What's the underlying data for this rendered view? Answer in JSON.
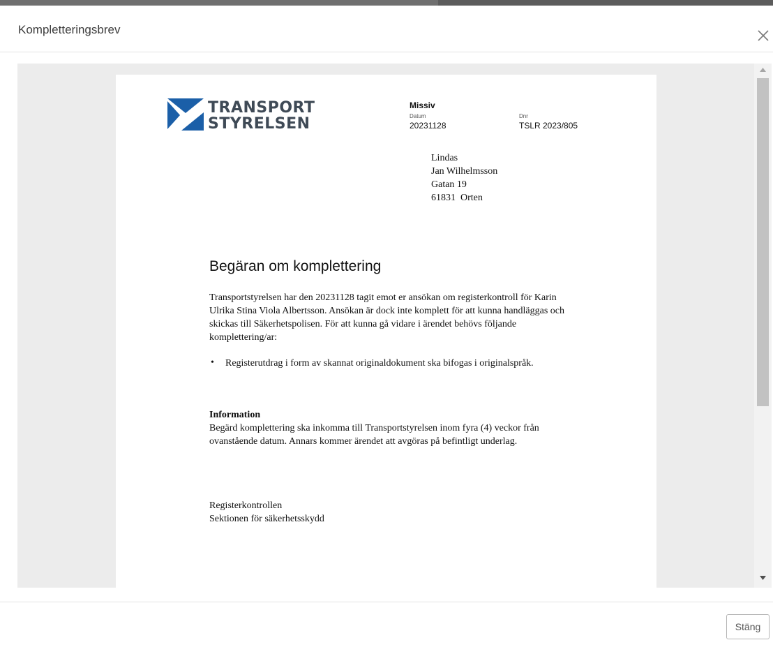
{
  "dialog": {
    "title": "Kompletteringsbrev",
    "close_button": "Stäng"
  },
  "letter": {
    "logo": {
      "line1": "TRANSPORT",
      "line2": "STYRELSEN"
    },
    "missiv_label": "Missiv",
    "datum_label": "Datum",
    "datum_value": "20231128",
    "dnr_label": "Dnr",
    "dnr_value": "TSLR 2023/805",
    "address": [
      "Lindas",
      "Jan Wilhelmsson",
      "Gatan 19",
      "61831  Orten"
    ],
    "heading": "Begäran om komplettering",
    "intro": "Transportstyrelsen har den 20231128 tagit emot er ansökan om registerkontroll för Karin Ulrika Stina Viola Albertsson. Ansökan är dock inte komplett för att kunna handläggas och skickas till Säkerhetspolisen. För att kunna gå vidare i ärendet behövs följande komplettering/ar:",
    "bullets": [
      "Registerutdrag i form av skannat originaldokument ska bifogas i originalspråk."
    ],
    "info_heading": "Information",
    "info_text": "Begärd komplettering ska inkomma till Transportstyrelsen inom fyra (4) veckor från ovanstående datum. Annars kommer ärendet att avgöras på befintligt underlag.",
    "signature": [
      "Registerkontrollen",
      "Sektionen för säkerhetsskydd"
    ]
  },
  "colors": {
    "logo_blue": "#1b5fa8",
    "logo_text": "#3f4a56",
    "viewer_bg": "#ececec"
  }
}
